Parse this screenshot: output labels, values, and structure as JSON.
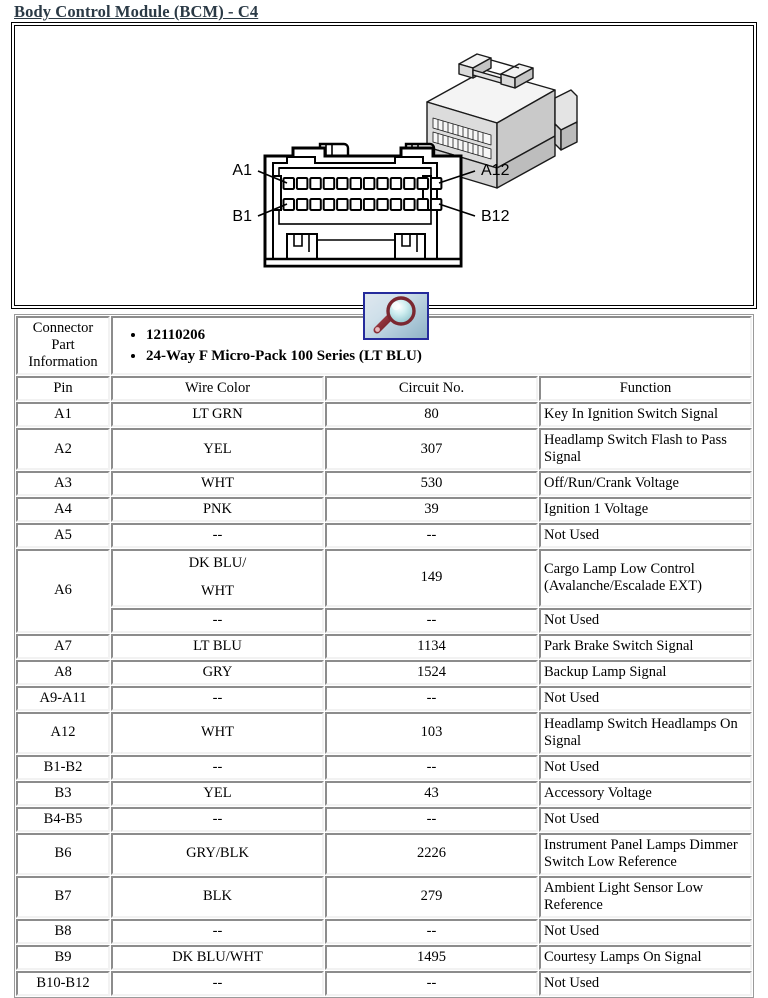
{
  "page": {
    "title": "Body Control Module (BCM) - C4",
    "title_color": "#2b3a46"
  },
  "diagram": {
    "name": "connector-face-view",
    "labels": {
      "a1": "A1",
      "a12": "A12",
      "b1": "B1",
      "b12": "B12"
    },
    "rows": 2,
    "pins_per_row": 12,
    "magnifier": {
      "icon": "magnifier-icon",
      "border_color": "#252b9c",
      "glass_color": "#8a2franchise"
    }
  },
  "table": {
    "part_info": {
      "label": "Connector Part Information",
      "items": [
        "12110206",
        "24-Way F Micro-Pack 100 Series (LT BLU)"
      ]
    },
    "headers": {
      "pin": "Pin",
      "wire_color": "Wire Color",
      "circuit_no": "Circuit No.",
      "function": "Function"
    },
    "rows": [
      {
        "pin": "A1",
        "wire_color": "LT GRN",
        "circuit_no": "80",
        "function": "Key In Ignition Switch Signal"
      },
      {
        "pin": "A2",
        "wire_color": "YEL",
        "circuit_no": "307",
        "function": "Headlamp Switch Flash to Pass Signal"
      },
      {
        "pin": "A3",
        "wire_color": "WHT",
        "circuit_no": "530",
        "function": "Off/Run/Crank Voltage"
      },
      {
        "pin": "A4",
        "wire_color": "PNK",
        "circuit_no": "39",
        "function": "Ignition 1 Voltage"
      },
      {
        "pin": "A5",
        "wire_color": "--",
        "circuit_no": "--",
        "function": "Not Used"
      },
      {
        "pin": "A6",
        "wire_color": "DK BLU/",
        "wire_color_2": "WHT",
        "circuit_no": "149",
        "function": "Cargo Lamp Low Control (Avalanche/Escalade EXT)",
        "rowspan": 2
      },
      {
        "pin": "",
        "wire_color": "--",
        "circuit_no": "--",
        "function": "Not Used"
      },
      {
        "pin": "A7",
        "wire_color": "LT BLU",
        "circuit_no": "1134",
        "function": "Park Brake Switch Signal"
      },
      {
        "pin": "A8",
        "wire_color": "GRY",
        "circuit_no": "1524",
        "function": "Backup Lamp Signal"
      },
      {
        "pin": "A9-A11",
        "wire_color": "--",
        "circuit_no": "--",
        "function": "Not Used"
      },
      {
        "pin": "A12",
        "wire_color": "WHT",
        "circuit_no": "103",
        "function": "Headlamp Switch Headlamps On Signal"
      },
      {
        "pin": "B1-B2",
        "wire_color": "--",
        "circuit_no": "--",
        "function": "Not Used"
      },
      {
        "pin": "B3",
        "wire_color": "YEL",
        "circuit_no": "43",
        "function": "Accessory Voltage"
      },
      {
        "pin": "B4-B5",
        "wire_color": "--",
        "circuit_no": "--",
        "function": "Not Used"
      },
      {
        "pin": "B6",
        "wire_color": "GRY/BLK",
        "circuit_no": "2226",
        "function": "Instrument Panel Lamps Dimmer Switch Low Reference"
      },
      {
        "pin": "B7",
        "wire_color": "BLK",
        "circuit_no": "279",
        "function": "Ambient Light Sensor Low Reference"
      },
      {
        "pin": "B8",
        "wire_color": "--",
        "circuit_no": "--",
        "function": "Not Used"
      },
      {
        "pin": "B9",
        "wire_color": "DK BLU/WHT",
        "circuit_no": "1495",
        "function": "Courtesy Lamps On Signal"
      },
      {
        "pin": "B10-B12",
        "wire_color": "--",
        "circuit_no": "--",
        "function": "Not Used"
      }
    ]
  }
}
